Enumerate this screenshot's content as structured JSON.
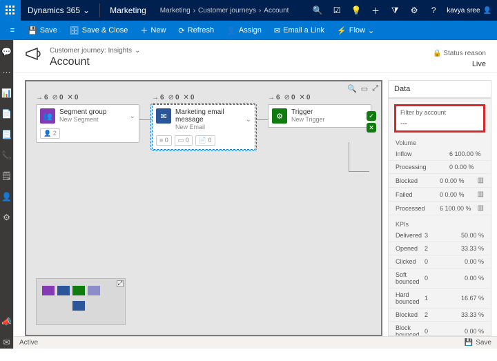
{
  "topbar": {
    "brand": "Dynamics 365",
    "app": "Marketing",
    "crumbs": [
      "Marketing",
      "Customer journeys",
      "Account"
    ],
    "user": "kavya sree"
  },
  "cmdbar": {
    "save": "Save",
    "saveclose": "Save & Close",
    "new": "New",
    "refresh": "Refresh",
    "assign": "Assign",
    "email": "Email a Link",
    "flow": "Flow"
  },
  "header": {
    "pre": "Customer journey: Insights",
    "title": "Account",
    "status_label": "Status reason",
    "status_value": "Live"
  },
  "tiles": {
    "segment": {
      "title": "Segment group",
      "sub": "New Segment",
      "people": "2"
    },
    "email": {
      "title": "Marketing email message",
      "sub": "New Email"
    },
    "trigger": {
      "title": "Trigger",
      "sub": "New Trigger"
    },
    "stats_a": "6",
    "stats_b": "0",
    "stats_c": "0"
  },
  "side": {
    "tab": "Data",
    "filter_label": "Filter by account",
    "filter_value": "---",
    "volume_title": "Volume",
    "volume": [
      {
        "k": "Inflow",
        "v": "6",
        "pct": "100.00 %"
      },
      {
        "k": "Processing",
        "v": "0",
        "pct": "0.00 %"
      },
      {
        "k": "Blocked",
        "v": "0",
        "pct": "0.00 %"
      },
      {
        "k": "Failed",
        "v": "0",
        "pct": "0.00 %"
      },
      {
        "k": "Processed",
        "v": "6",
        "pct": "100.00 %"
      }
    ],
    "kpi_title": "KPIs",
    "kpis": [
      {
        "k": "Delivered",
        "v": "3",
        "pct": "50.00 %"
      },
      {
        "k": "Opened",
        "v": "2",
        "pct": "33.33 %"
      },
      {
        "k": "Clicked",
        "v": "0",
        "pct": "0.00 %"
      },
      {
        "k": "Soft bounced",
        "v": "0",
        "pct": "0.00 %"
      },
      {
        "k": "Hard bounced",
        "v": "1",
        "pct": "16.67 %"
      },
      {
        "k": "Blocked",
        "v": "2",
        "pct": "33.33 %"
      },
      {
        "k": "Block bounced",
        "v": "0",
        "pct": "0.00 %"
      }
    ]
  },
  "statusbar": {
    "left": "Active",
    "save": "Save"
  }
}
